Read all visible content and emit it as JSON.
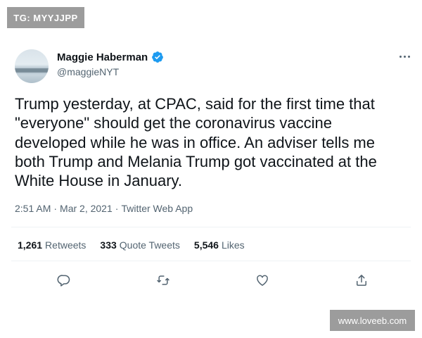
{
  "watermarks": {
    "top": "TG: MYYJJPP",
    "bottom": "www.loveeb.com"
  },
  "tweet": {
    "author": {
      "name": "Maggie Haberman",
      "handle": "@maggieNYT",
      "verified": true
    },
    "text": "Trump yesterday, at CPAC, said for the first time that\n\"everyone\" should get the coronavirus vaccine\ndeveloped while he was in office. An adviser tells me\nboth Trump and Melania Trump got vaccinated at the\nWhite House in January.",
    "time": "2:51 AM",
    "separator": "·",
    "date": "Mar 2, 2021",
    "source": "Twitter Web App",
    "stats": {
      "retweets_count": "1,261",
      "retweets_label": "Retweets",
      "quotes_count": "333",
      "quotes_label": "Quote Tweets",
      "likes_count": "5,546",
      "likes_label": "Likes"
    }
  },
  "icons": {
    "verified": "verified-badge-icon",
    "more": "more-dots-icon",
    "reply": "reply-icon",
    "retweet": "retweet-icon",
    "like": "heart-icon",
    "share": "share-icon"
  },
  "colors": {
    "verified_blue": "#1d9bf0",
    "text_primary": "#0f1419",
    "text_secondary": "#536471",
    "watermark_bg": "#9c9c9c"
  }
}
